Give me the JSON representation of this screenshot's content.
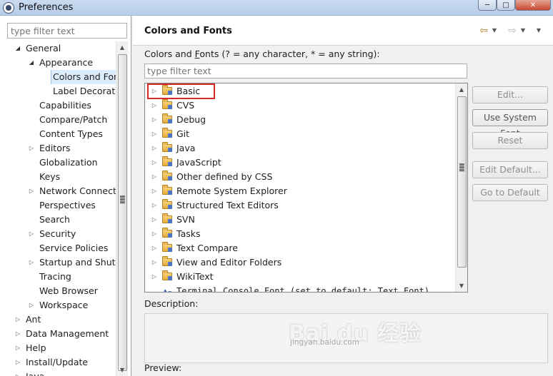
{
  "window": {
    "title": "Preferences",
    "controls": {
      "minimize": "─",
      "maximize": "□",
      "close": "✕"
    }
  },
  "left_pane": {
    "filter_placeholder": "type filter text",
    "tree": [
      {
        "label": "General",
        "level": 1,
        "twisty": "open"
      },
      {
        "label": "Appearance",
        "level": 2,
        "twisty": "open"
      },
      {
        "label": "Colors and Fonts",
        "level": 3,
        "twisty": "none",
        "selected": true
      },
      {
        "label": "Label Decorations",
        "level": 3,
        "twisty": "none"
      },
      {
        "label": "Capabilities",
        "level": 2,
        "twisty": "none"
      },
      {
        "label": "Compare/Patch",
        "level": 2,
        "twisty": "none"
      },
      {
        "label": "Content Types",
        "level": 2,
        "twisty": "none"
      },
      {
        "label": "Editors",
        "level": 2,
        "twisty": "closed"
      },
      {
        "label": "Globalization",
        "level": 2,
        "twisty": "none"
      },
      {
        "label": "Keys",
        "level": 2,
        "twisty": "none"
      },
      {
        "label": "Network Connections",
        "level": 2,
        "twisty": "closed"
      },
      {
        "label": "Perspectives",
        "level": 2,
        "twisty": "none"
      },
      {
        "label": "Search",
        "level": 2,
        "twisty": "none"
      },
      {
        "label": "Security",
        "level": 2,
        "twisty": "closed"
      },
      {
        "label": "Service Policies",
        "level": 2,
        "twisty": "none"
      },
      {
        "label": "Startup and Shutdown",
        "level": 2,
        "twisty": "closed"
      },
      {
        "label": "Tracing",
        "level": 2,
        "twisty": "none"
      },
      {
        "label": "Web Browser",
        "level": 2,
        "twisty": "none"
      },
      {
        "label": "Workspace",
        "level": 2,
        "twisty": "closed"
      },
      {
        "label": "Ant",
        "level": 1,
        "twisty": "closed"
      },
      {
        "label": "Data Management",
        "level": 1,
        "twisty": "closed"
      },
      {
        "label": "Help",
        "level": 1,
        "twisty": "closed"
      },
      {
        "label": "Install/Update",
        "level": 1,
        "twisty": "closed"
      },
      {
        "label": "Java",
        "level": 1,
        "twisty": "closed"
      }
    ]
  },
  "page": {
    "title": "Colors and Fonts",
    "instruction": "Colors and Fonts (? = any character, * = any string):",
    "instruction_parts": {
      "before": "Colors and ",
      "mnemonic": "F",
      "after": "onts (? = any character, * = any string):"
    },
    "filter_placeholder": "type filter text",
    "categories": [
      {
        "label": "Basic",
        "highlighted": true
      },
      {
        "label": "CVS"
      },
      {
        "label": "Debug"
      },
      {
        "label": "Git"
      },
      {
        "label": "Java"
      },
      {
        "label": "JavaScript"
      },
      {
        "label": "Other defined by CSS"
      },
      {
        "label": "Remote System Explorer"
      },
      {
        "label": "Structured Text Editors"
      },
      {
        "label": "SVN"
      },
      {
        "label": "Tasks"
      },
      {
        "label": "Text Compare"
      },
      {
        "label": "View and Editor Folders"
      },
      {
        "label": "WikiText"
      }
    ],
    "font_entry": {
      "icon_text": "Aa",
      "label": "Terminal Console Font (set to default: Text Font)"
    },
    "buttons": {
      "edit": "Edit...",
      "use_system_font": "Use System Font",
      "reset": "Reset",
      "edit_default": "Edit Default...",
      "go_to_default": "Go to Default"
    },
    "description_label": "Description:",
    "preview_label": "Preview:"
  },
  "watermark": {
    "text": "Bai du 经验",
    "sub": "jingyan.baidu.com"
  }
}
